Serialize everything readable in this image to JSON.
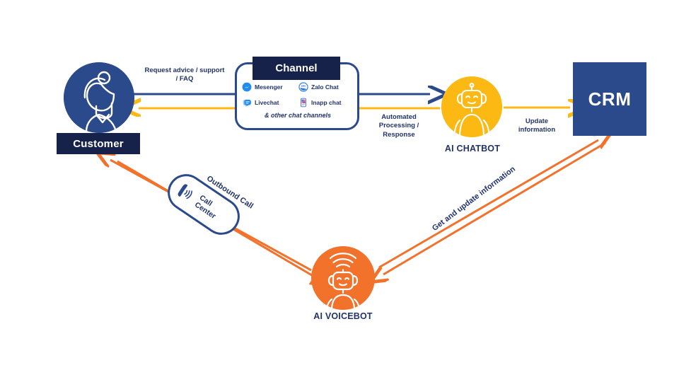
{
  "diagram": {
    "title": "AI Chatbot and AI Voicebot customer service flow",
    "colors": {
      "navy_dark": "#17224a",
      "blue": "#2b4a8b",
      "yellow": "#fcb813",
      "orange": "#f2722b",
      "white": "#ffffff"
    }
  },
  "nodes": {
    "customer": {
      "label": "Customer",
      "icon": "woman-avatar-icon"
    },
    "channel": {
      "title": "Channel",
      "items": [
        {
          "label": "Mesenger",
          "icon": "messenger-icon"
        },
        {
          "label": "Zalo Chat",
          "icon": "zalo-icon"
        },
        {
          "label": "Livechat",
          "icon": "livechat-icon"
        },
        {
          "label": "Inapp chat",
          "icon": "inapp-chat-icon"
        }
      ],
      "footer": "& other chat channels"
    },
    "chatbot": {
      "label": "AI CHATBOT",
      "icon": "robot-headset-icon"
    },
    "crm": {
      "label": "CRM"
    },
    "voicebot": {
      "label": "AI VOICEBOT",
      "icon": "robot-headset-wifi-icon"
    },
    "callcenter": {
      "line1": "Call",
      "line2": "Center",
      "icon": "phone-ringing-icon"
    }
  },
  "edges": {
    "request": "Request advice / support\n/ FAQ",
    "automated": "Automated\nProcessing /\nResponse",
    "update": "Update\ninformation",
    "outbound": "Outbound Call",
    "get_update": "Get and update information"
  }
}
